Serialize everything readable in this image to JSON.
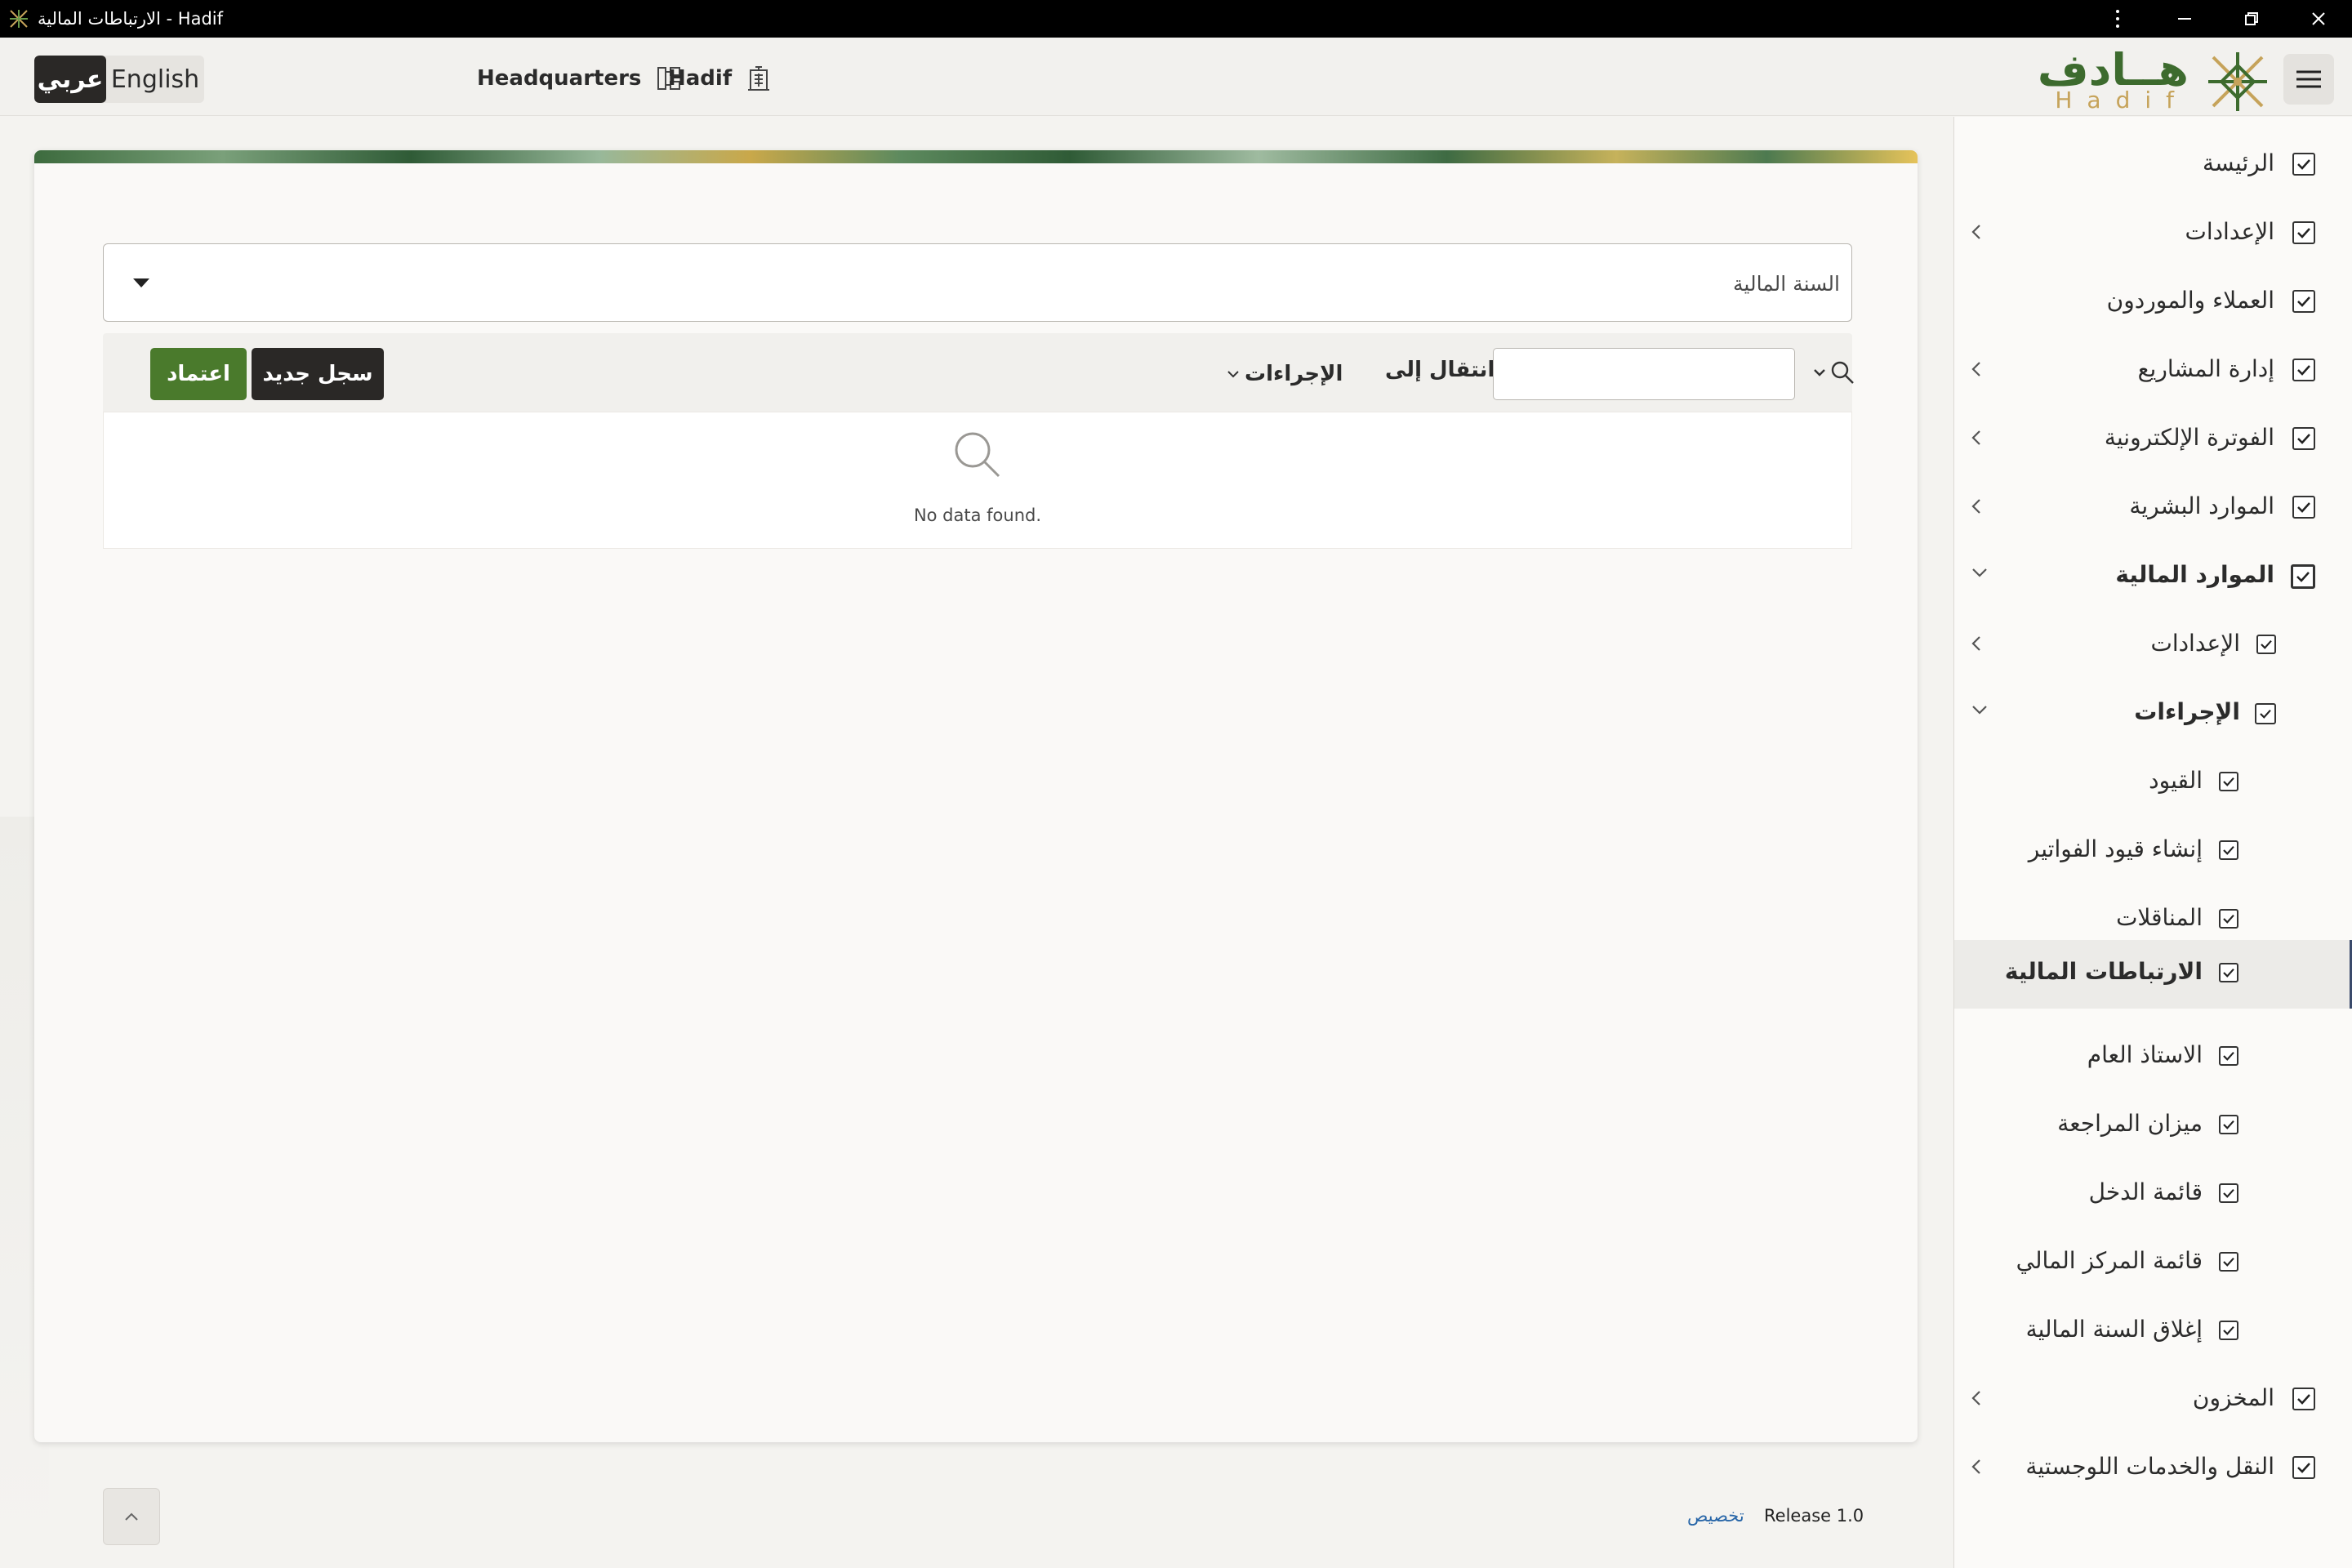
{
  "window": {
    "title": "الارتباطات المالية - Hadif"
  },
  "header": {
    "lang_active": "عربي",
    "lang_other": "English",
    "branch": "Headquarters",
    "company": "Hadif",
    "logo_ar": "هــادف",
    "logo_en": "Hadif"
  },
  "filter": {
    "fiscal_year_label": "السنة المالية"
  },
  "toolbar": {
    "approve_label": "اعتماد",
    "new_record_label": "سجل جديد",
    "actions_label": "الإجراءات",
    "goto_label": "انتقال إلى",
    "search_value": ""
  },
  "results": {
    "empty_text": "No data found."
  },
  "footer": {
    "customize_label": "تخصيص",
    "release_label": "Release 1.0"
  },
  "sidebar": {
    "items": [
      {
        "label": "الرئيسة"
      },
      {
        "label": "الإعدادات"
      },
      {
        "label": "العملاء والموردون"
      },
      {
        "label": "إدارة المشاريع"
      },
      {
        "label": "الفوترة الإلكترونية"
      },
      {
        "label": "الموارد البشرية"
      },
      {
        "label": "الموارد المالية"
      },
      {
        "label": "الإعدادات"
      },
      {
        "label": "الإجراءات"
      },
      {
        "label": "القيود"
      },
      {
        "label": "إنشاء قيود الفواتير"
      },
      {
        "label": "المناقلات"
      },
      {
        "label": "الارتباطات المالية"
      },
      {
        "label": "الاستاذ العام"
      },
      {
        "label": "ميزان المراجعة"
      },
      {
        "label": "قائمة الدخل"
      },
      {
        "label": "قائمة المركز المالي"
      },
      {
        "label": "إغلاق السنة المالية"
      },
      {
        "label": "المخزون"
      },
      {
        "label": "النقل والخدمات اللوجستية"
      }
    ]
  },
  "colors": {
    "brand_green": "#4a7a2c",
    "dark_button": "#2a2826",
    "logo_gold": "#c6a35a",
    "link_blue": "#2866a8"
  }
}
